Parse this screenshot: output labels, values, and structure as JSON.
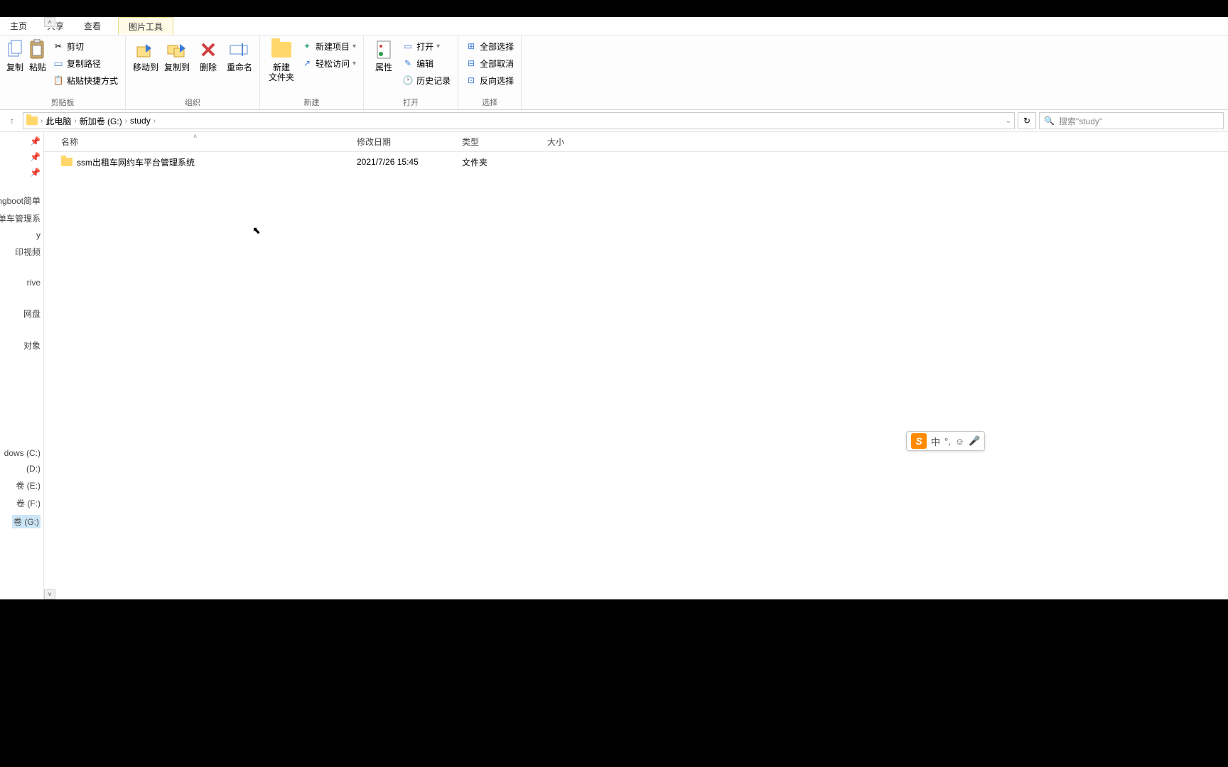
{
  "tabs": {
    "home": "主页",
    "share": "共享",
    "view": "查看",
    "picture_tools": "图片工具"
  },
  "ribbon": {
    "clipboard": {
      "copy": "复制",
      "paste": "粘贴",
      "cut": "剪切",
      "copy_path": "复制路径",
      "paste_shortcut": "粘贴快捷方式",
      "group_label": "剪贴板"
    },
    "organize": {
      "move_to": "移动到",
      "copy_to": "复制到",
      "delete": "删除",
      "rename": "重命名",
      "group_label": "组织"
    },
    "new": {
      "new_folder": "新建\n文件夹",
      "new_item": "新建项目",
      "easy_access": "轻松访问",
      "group_label": "新建"
    },
    "open": {
      "properties": "属性",
      "open": "打开",
      "edit": "编辑",
      "history": "历史记录",
      "group_label": "打开"
    },
    "select": {
      "select_all": "全部选择",
      "select_none": "全部取消",
      "invert": "反向选择",
      "group_label": "选择"
    }
  },
  "breadcrumb": {
    "this_pc": "此电脑",
    "volume": "新加卷 (G:)",
    "folder": "study"
  },
  "address": {
    "refresh_icon": "↻"
  },
  "search": {
    "placeholder": "搜索\"study\""
  },
  "columns": {
    "name": "名称",
    "date": "修改日期",
    "type": "类型",
    "size": "大小"
  },
  "files": [
    {
      "name": "ssm出租车网约车平台管理系统",
      "date": "2021/7/26 15:45",
      "type": "文件夹",
      "size": ""
    }
  ],
  "nav": {
    "items": [
      "ngboot简单",
      "单车管理系",
      "y",
      "印视频",
      "rive",
      "网盘",
      "对象"
    ],
    "drives": [
      "dows (C:)",
      "(D:)",
      "卷 (E:)",
      "卷 (F:)",
      "卷 (G:)"
    ]
  },
  "ime": {
    "lang": "中",
    "punct": "°,",
    "emoji": "☺",
    "mic": "🎤"
  },
  "cursor": "⬉"
}
